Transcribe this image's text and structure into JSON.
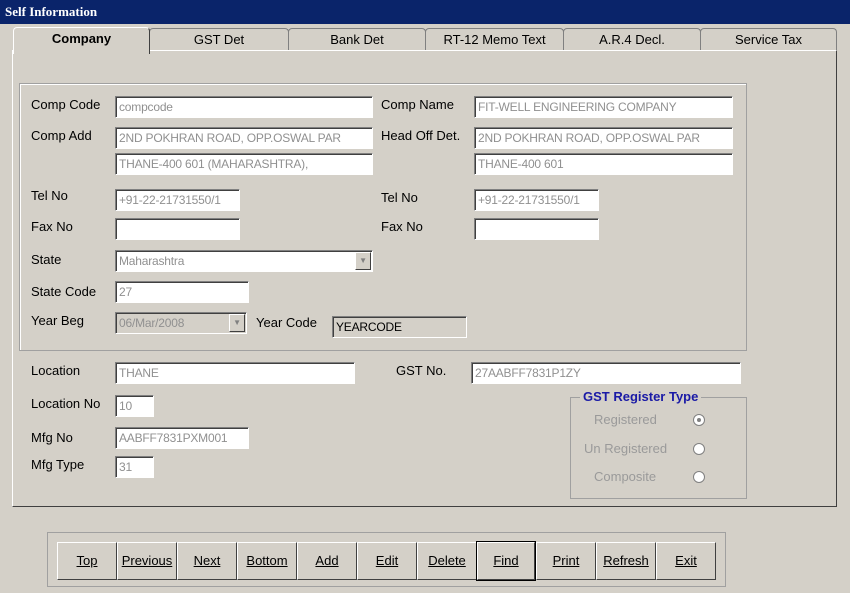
{
  "window": {
    "title": "Self Information"
  },
  "tabs": [
    "Company",
    "GST Det",
    "Bank Det",
    "RT-12 Memo Text",
    "A.R.4 Decl.",
    "Service Tax"
  ],
  "labels": {
    "comp_code": "Comp Code",
    "comp_name": "Comp Name",
    "comp_add": "Comp Add",
    "head_off": "Head Off Det.",
    "tel_no": "Tel No",
    "tel_no2": "Tel No",
    "fax_no": "Fax No",
    "fax_no2": "Fax No",
    "state": "State",
    "state_code": "State Code",
    "year_beg": "Year Beg",
    "year_code": "Year Code",
    "location": "Location",
    "gst_no": "GST No.",
    "location_no": "Location  No",
    "mfg_no": "Mfg No",
    "mfg_type": "Mfg Type"
  },
  "fields": {
    "comp_code": "compcode",
    "comp_name": "FIT-WELL ENGINEERING COMPANY",
    "comp_add1": "2ND POKHRAN ROAD, OPP.OSWAL PAR",
    "comp_add2": "THANE-400 601 (MAHARASHTRA),",
    "head_off1": "2ND POKHRAN ROAD, OPP.OSWAL PAR",
    "head_off2": "THANE-400 601",
    "tel_no": "+91-22-21731550/1",
    "tel_no2": "+91-22-21731550/1",
    "fax_no": "",
    "fax_no2": "",
    "state": "Maharashtra",
    "state_code": "27",
    "year_beg": "06/Mar/2008",
    "year_code": "YEARCODE",
    "location": "THANE",
    "gst_no": "27AABFF7831P1ZY",
    "location_no": "10",
    "mfg_no": "AABFF7831PXM001",
    "mfg_type": "31"
  },
  "gst_register": {
    "title": "GST Register Type",
    "options": [
      "Registered",
      "Un Registered",
      "Composite"
    ],
    "selected": "Registered"
  },
  "buttons": [
    "Top",
    "Previous",
    "Next",
    "Bottom",
    "Add",
    "Edit",
    "Delete",
    "Find",
    "Print",
    "Refresh",
    "Exit"
  ],
  "icons": {
    "dropdown": "chevron-down-icon"
  }
}
